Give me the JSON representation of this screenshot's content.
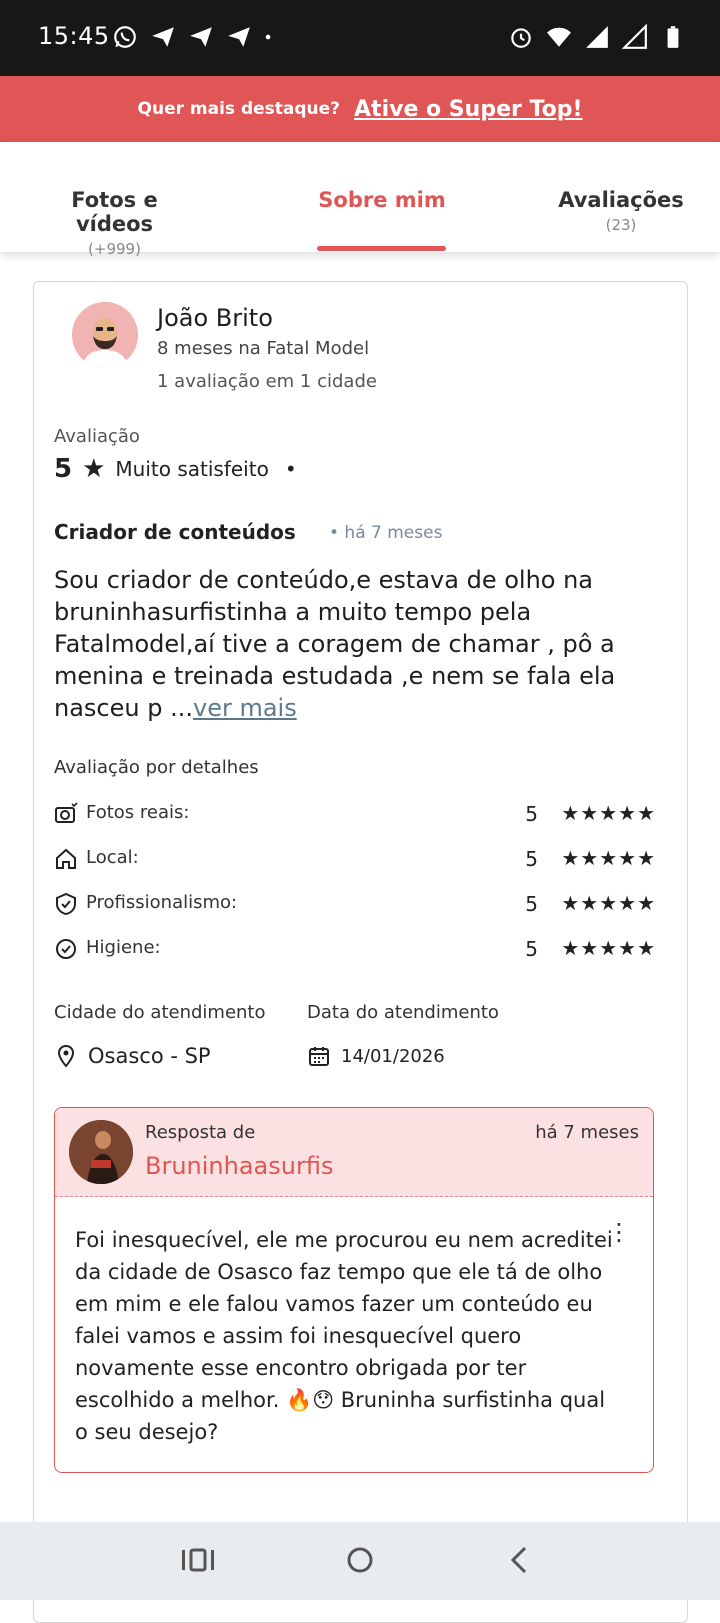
{
  "status_bar": {
    "time": "15:45",
    "left_icons": [
      "whatsapp-icon",
      "telegram-icon",
      "telegram-icon",
      "telegram-icon",
      "dot-icon"
    ],
    "right_icons": [
      "alarm-icon",
      "wifi-icon",
      "signal-icon",
      "signal-icon",
      "battery-icon"
    ]
  },
  "promo": {
    "question": "Quer mais destaque?",
    "cta": "Ative o Super Top!"
  },
  "tabs": [
    {
      "label": "Fotos e vídeos",
      "count": "(+999)"
    },
    {
      "label": "Sobre mim",
      "count": ""
    },
    {
      "label": "Avaliações",
      "count": "(23)"
    }
  ],
  "active_tab": "Sobre mim",
  "review": {
    "reviewer_name": "João Brito",
    "member_since": "8 meses na Fatal Model",
    "reviews_count": "1 avaliação em 1 cidade",
    "rating_label": "Avaliação",
    "rating_value": "5",
    "rating_text": "Muito satisfeito",
    "reviewer_type": "Criador de conteúdos",
    "reviewer_time": "• há 7 meses",
    "text": "Sou criador de conteúdo,e estava de olho na bruninhasurfistinha a muito tempo pela Fatalmodel,aí tive a coragem de chamar , pô a menina e treinada estudada ,e nem se fala ela nasceu p ...",
    "see_more": "ver mais",
    "details_title": "Avaliação por detalhes",
    "details": [
      {
        "icon": "camera-icon",
        "label": "Fotos reais:",
        "value": "5",
        "stars": "★★★★★"
      },
      {
        "icon": "home-icon",
        "label": "Local:",
        "value": "5",
        "stars": "★★★★★"
      },
      {
        "icon": "shield-icon",
        "label": "Profissionalismo:",
        "value": "5",
        "stars": "★★★★★"
      },
      {
        "icon": "check-circle-icon",
        "label": "Higiene:",
        "value": "5",
        "stars": "★★★★★"
      }
    ],
    "city_label": "Cidade do atendimento",
    "city_value": "Osasco - SP",
    "date_label": "Data do atendimento",
    "date_value": "14/01/2026"
  },
  "reply": {
    "from_label": "Resposta de",
    "name": "Bruninhaasurfis",
    "time": "há 7 meses",
    "text": "Foi inesquecível, ele me procurou eu nem acreditei da cidade de Osasco faz tempo que ele tá de olho em mim e ele falou vamos fazer um conteúdo eu falei vamos e assim foi inesquecível quero novamente esse encontro obrigada por ter escolhido a melhor. 🔥😯 Bruninha surfistinha qual o seu desejo?"
  },
  "colors": {
    "accent": "#e05555",
    "status_bar": "#171717",
    "reply_bg": "#fbe1e1",
    "link": "#5c7a8c"
  }
}
